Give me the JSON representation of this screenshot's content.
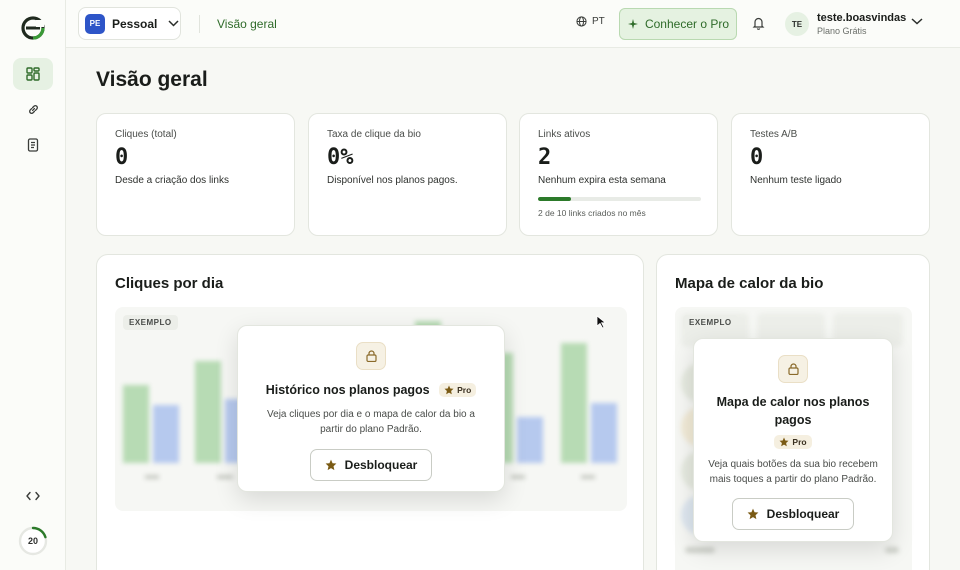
{
  "topbar": {
    "workspace_badge": "PE",
    "workspace_name": "Pessoal",
    "breadcrumb": "Visão geral",
    "language": "PT",
    "pro_button": "Conhecer o Pro",
    "user_initials": "TE",
    "user_name": "teste.boasvindas",
    "user_plan": "Plano Grátis"
  },
  "rail": {
    "items": [
      "dashboard-icon",
      "link-icon",
      "document-icon"
    ],
    "code_icon": "code-icon",
    "usage_value": "20",
    "usage_fraction": 0.2
  },
  "page": {
    "title": "Visão geral"
  },
  "stats": [
    {
      "label": "Cliques (total)",
      "value": "0",
      "sub": "Desde a criação dos links"
    },
    {
      "label": "Taxa de clique da bio",
      "value": "0%",
      "sub": "Disponível nos planos pagos."
    },
    {
      "label": "Links ativos",
      "value": "2",
      "sub": "Nenhum expira esta semana",
      "bar_fraction": 0.2,
      "bar_note": "2 de 10 links criados no mês"
    },
    {
      "label": "Testes A/B",
      "value": "0",
      "sub": "Nenhum teste ligado"
    }
  ],
  "clicks_panel": {
    "title": "Cliques por dia",
    "sample_tag": "EXEMPLO",
    "lock_title": "Histórico nos planos pagos",
    "pro_badge": "Pro",
    "lock_desc": "Veja cliques por dia e o mapa de calor da bio a partir do plano Padrão.",
    "unlock_label": "Desbloquear"
  },
  "heatmap_panel": {
    "title": "Mapa de calor da bio",
    "sample_tag": "EXEMPLO",
    "lock_title": "Mapa de calor nos planos pagos",
    "pro_badge": "Pro",
    "lock_desc": "Veja quais botões da sua bio recebem mais toques a partir do plano Padrão.",
    "unlock_label": "Desbloquear"
  },
  "colors": {
    "accent_green": "#2f6b2a",
    "pro_bg": "#e5f2e1",
    "bar_green": "#b7dbb4",
    "bar_blue": "#b6c9ee",
    "star": "#7a5a14"
  }
}
